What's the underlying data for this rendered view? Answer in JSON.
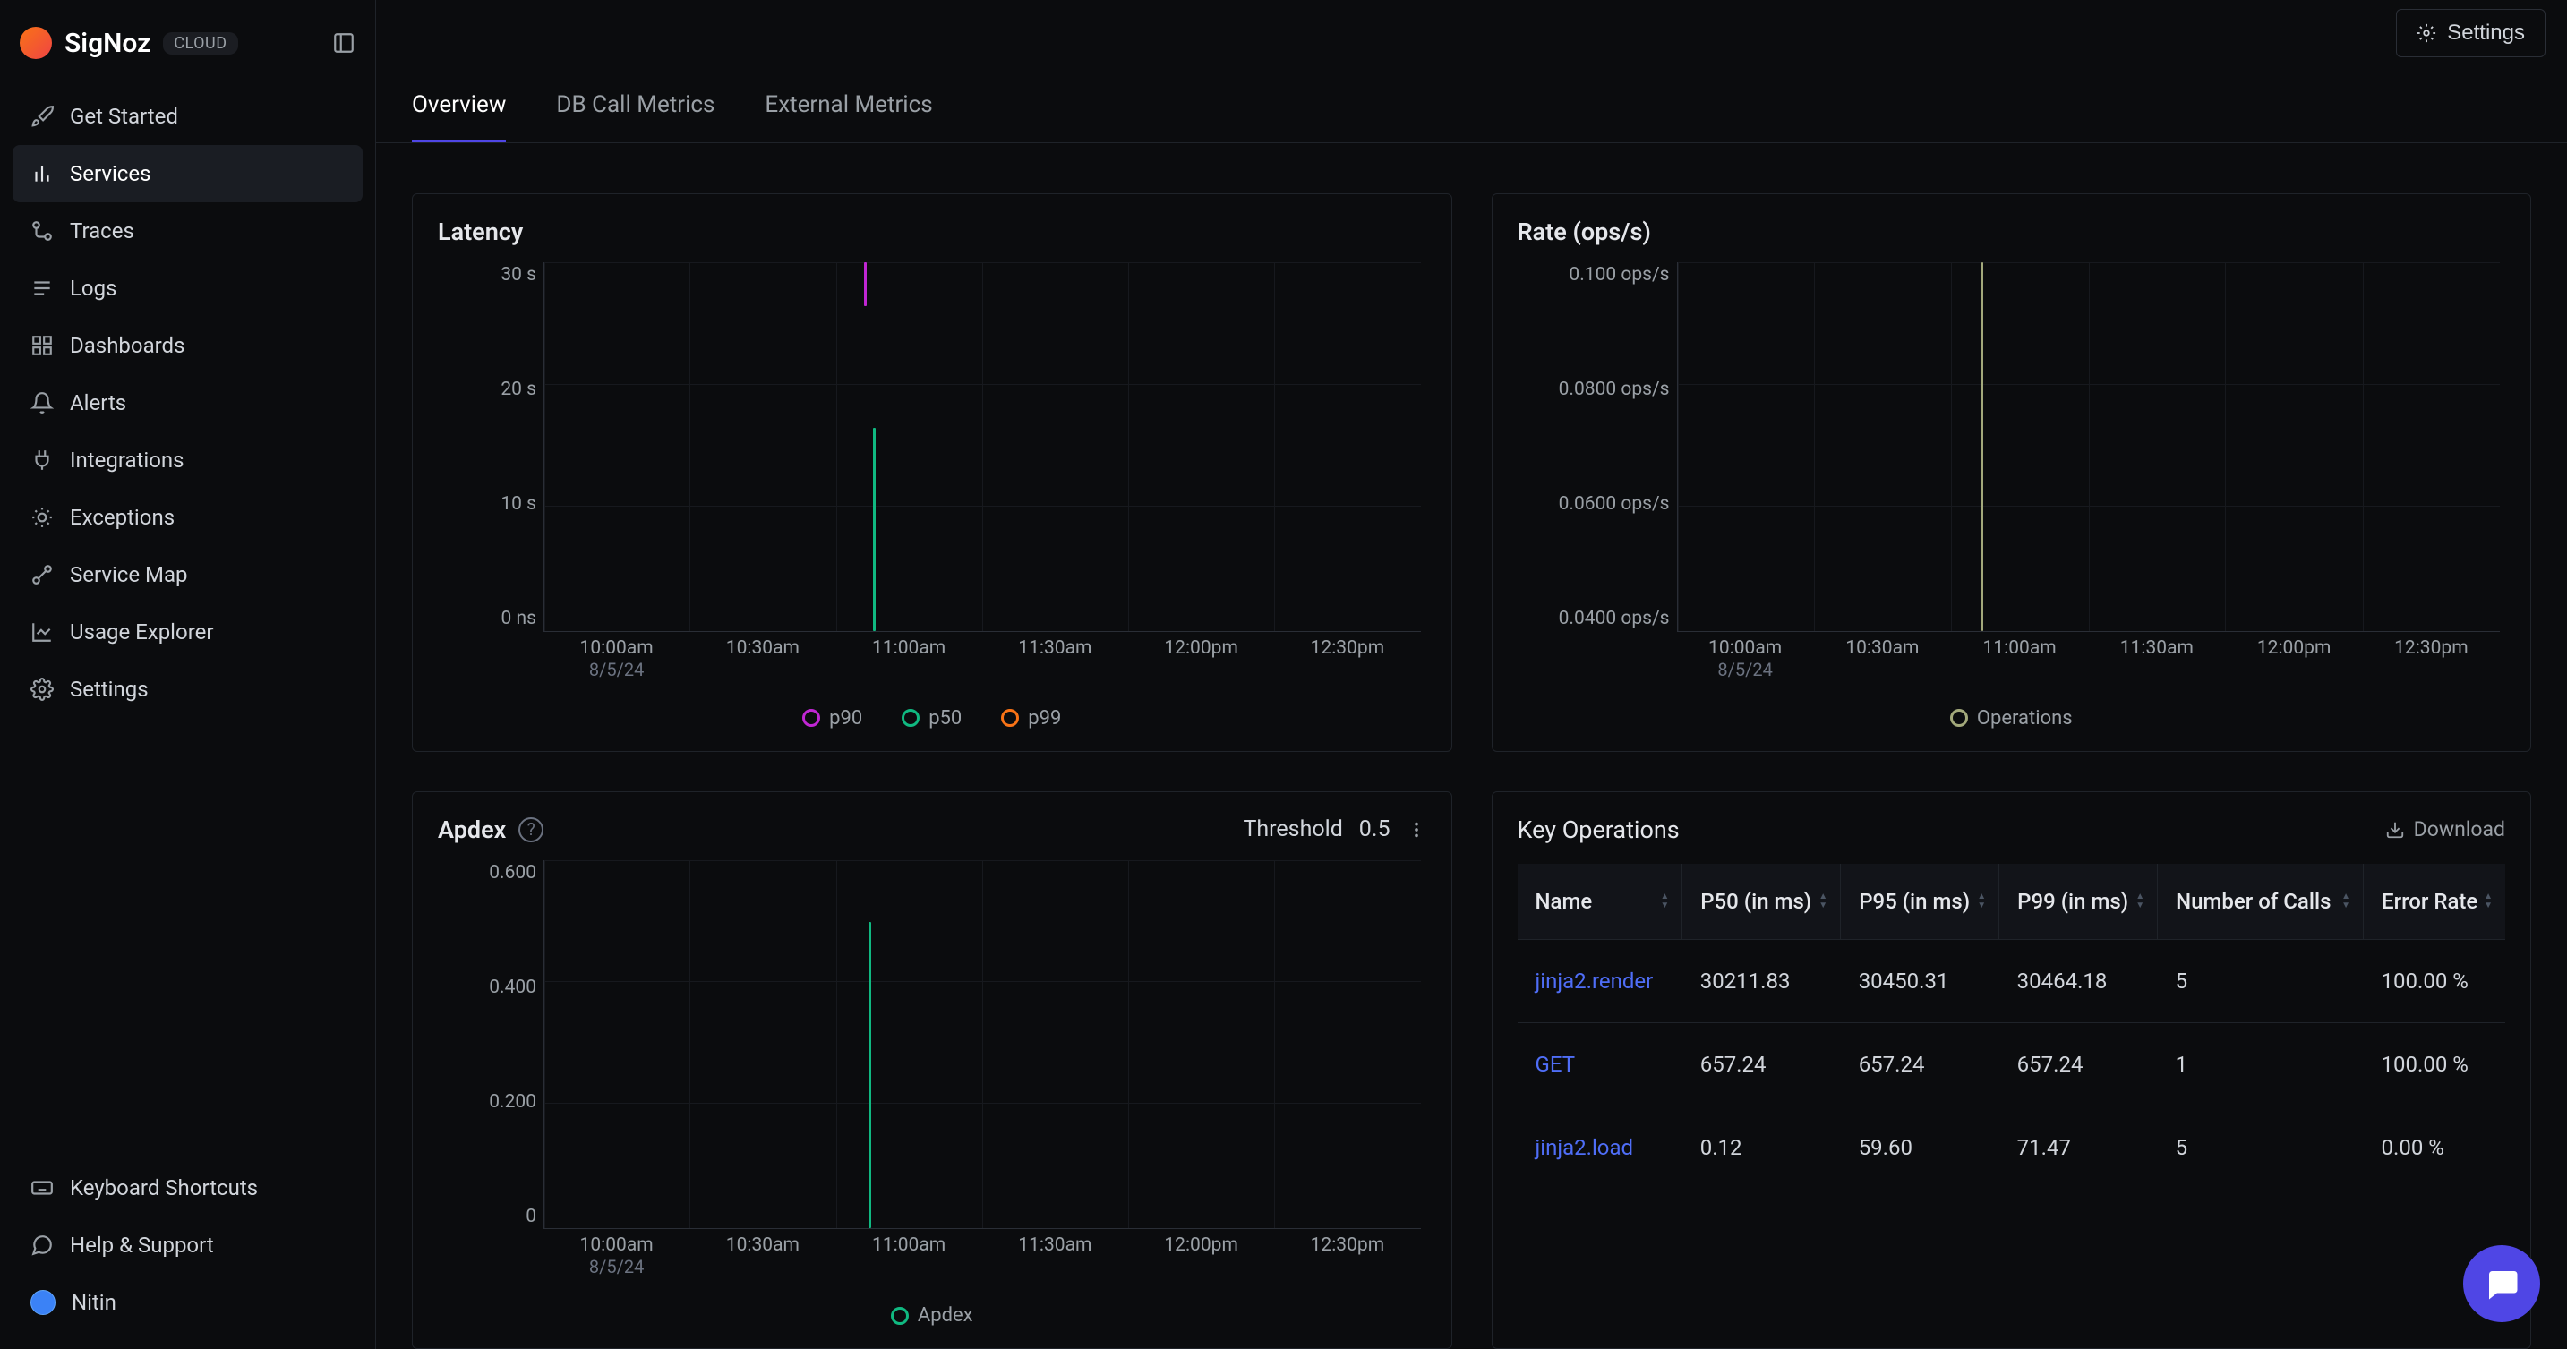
{
  "brand": {
    "name": "SigNoz",
    "badge": "CLOUD"
  },
  "sidebar": {
    "items": [
      {
        "label": "Get Started",
        "icon": "rocket-icon"
      },
      {
        "label": "Services",
        "icon": "bar-chart-icon",
        "active": true
      },
      {
        "label": "Traces",
        "icon": "hierarchy-icon"
      },
      {
        "label": "Logs",
        "icon": "logs-icon"
      },
      {
        "label": "Dashboards",
        "icon": "grid-icon"
      },
      {
        "label": "Alerts",
        "icon": "bell-icon"
      },
      {
        "label": "Integrations",
        "icon": "plug-icon"
      },
      {
        "label": "Exceptions",
        "icon": "bug-icon"
      },
      {
        "label": "Service Map",
        "icon": "route-icon"
      },
      {
        "label": "Usage Explorer",
        "icon": "chart-icon"
      },
      {
        "label": "Settings",
        "icon": "gear-icon"
      }
    ],
    "bottom": [
      {
        "label": "Keyboard Shortcuts",
        "icon": "keyboard-icon"
      },
      {
        "label": "Help & Support",
        "icon": "chat-icon"
      }
    ],
    "user": {
      "name": "Nitin"
    }
  },
  "topbar": {
    "settings_label": "Settings"
  },
  "tabs": [
    {
      "label": "Overview",
      "active": true
    },
    {
      "label": "DB Call Metrics"
    },
    {
      "label": "External Metrics"
    }
  ],
  "panels": {
    "latency": {
      "title": "Latency",
      "legend": [
        {
          "label": "p90",
          "color": "#c026d3"
        },
        {
          "label": "p50",
          "color": "#10b981"
        },
        {
          "label": "p99",
          "color": "#f97316"
        }
      ]
    },
    "rate": {
      "title": "Rate (ops/s)",
      "legend": [
        {
          "label": "Operations",
          "color": "#a3a97b"
        }
      ]
    },
    "apdex": {
      "title": "Apdex",
      "threshold_label": "Threshold",
      "threshold_value": "0.5",
      "legend": [
        {
          "label": "Apdex",
          "color": "#10b981"
        }
      ]
    },
    "key_ops": {
      "title": "Key Operations",
      "download_label": "Download",
      "columns": [
        "Name",
        "P50 (in ms)",
        "P95 (in ms)",
        "P99 (in ms)",
        "Number of Calls",
        "Error Rate"
      ],
      "rows": [
        {
          "name": "jinja2.render",
          "p50": "30211.83",
          "p95": "30450.31",
          "p99": "30464.18",
          "calls": "5",
          "err": "100.00 %"
        },
        {
          "name": "GET",
          "p50": "657.24",
          "p95": "657.24",
          "p99": "657.24",
          "calls": "1",
          "err": "100.00 %"
        },
        {
          "name": "jinja2.load",
          "p50": "0.12",
          "p95": "59.60",
          "p99": "71.47",
          "calls": "5",
          "err": "0.00 %"
        }
      ]
    }
  },
  "chart_data": [
    {
      "type": "line",
      "title": "Latency",
      "xlabel": "",
      "ylabel": "",
      "x_ticks": [
        "10:00am",
        "10:30am",
        "11:00am",
        "11:30am",
        "12:00pm",
        "12:30pm"
      ],
      "x_date": "8/5/24",
      "y_ticks": [
        "0 ns",
        "10 s",
        "20 s",
        "30 s"
      ],
      "ylim": [
        0,
        30
      ],
      "series": [
        {
          "name": "p90",
          "color": "#c026d3",
          "points": [
            {
              "x": "11:05am",
              "y": 30
            }
          ]
        },
        {
          "name": "p50",
          "color": "#10b981",
          "points": [
            {
              "x": "11:05am",
              "y": 14
            }
          ]
        },
        {
          "name": "p99",
          "color": "#f97316",
          "points": [
            {
              "x": "11:05am",
              "y": 30
            }
          ]
        }
      ]
    },
    {
      "type": "line",
      "title": "Rate (ops/s)",
      "xlabel": "",
      "ylabel": "",
      "x_ticks": [
        "10:00am",
        "10:30am",
        "11:00am",
        "11:30am",
        "12:00pm",
        "12:30pm"
      ],
      "x_date": "8/5/24",
      "y_ticks": [
        "0.0400 ops/s",
        "0.0600 ops/s",
        "0.0800 ops/s",
        "0.100 ops/s"
      ],
      "ylim": [
        0.033,
        0.1
      ],
      "series": [
        {
          "name": "Operations",
          "color": "#a3a97b",
          "points": [
            {
              "x": "11:05am",
              "y": 0.1
            }
          ]
        }
      ]
    },
    {
      "type": "line",
      "title": "Apdex",
      "xlabel": "",
      "ylabel": "",
      "x_ticks": [
        "10:00am",
        "10:30am",
        "11:00am",
        "11:30am",
        "12:00pm",
        "12:30pm"
      ],
      "x_date": "8/5/24",
      "y_ticks": [
        "0",
        "0.200",
        "0.400",
        "0.600"
      ],
      "ylim": [
        0,
        0.6
      ],
      "series": [
        {
          "name": "Apdex",
          "color": "#10b981",
          "points": [
            {
              "x": "11:05am",
              "y": 0.5
            }
          ]
        }
      ]
    }
  ]
}
